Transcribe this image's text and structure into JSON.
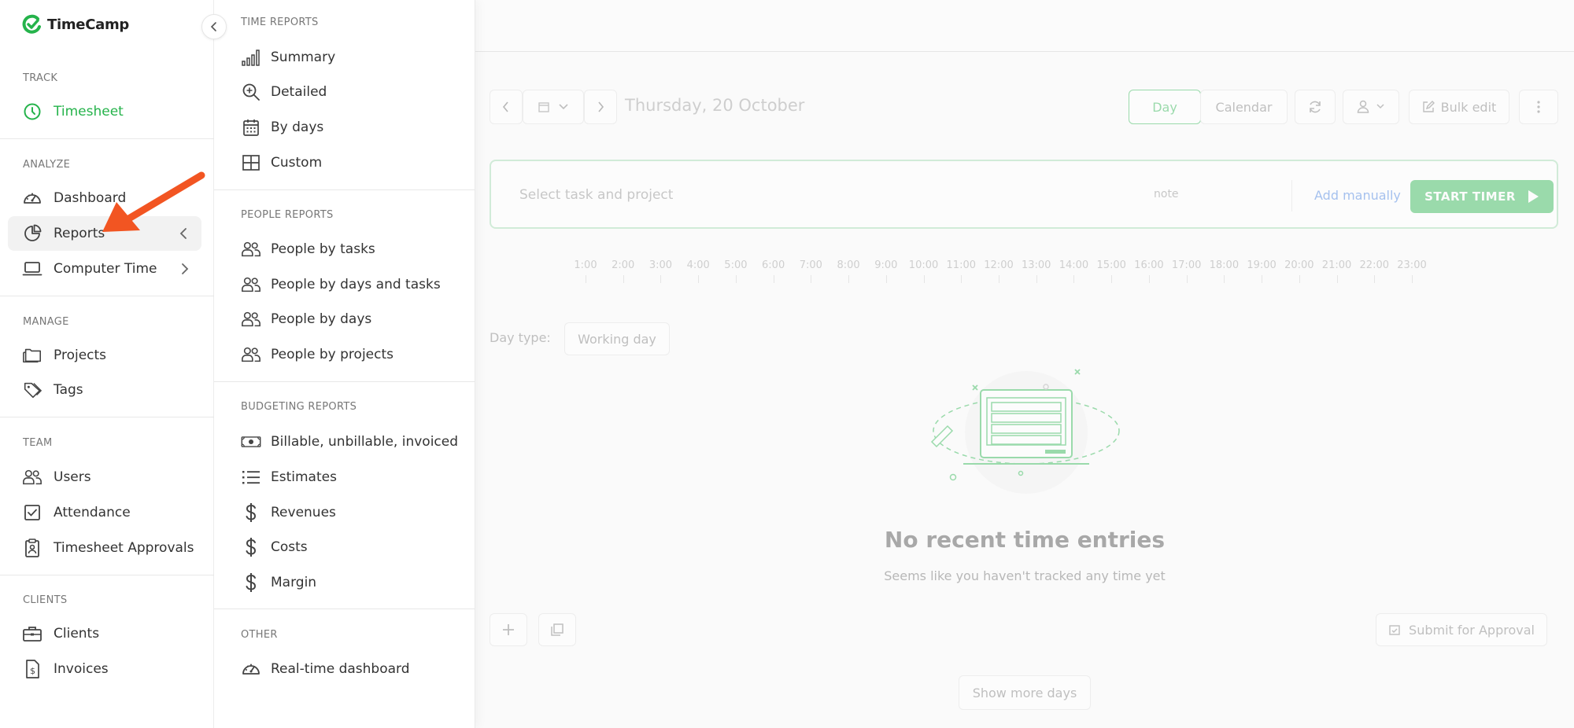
{
  "brand": {
    "name": "TimeCamp",
    "accent": "#25b34b"
  },
  "sidebar": {
    "sections": [
      {
        "title": "TRACK",
        "items": [
          {
            "label": "Timesheet",
            "icon": "clock-icon"
          }
        ]
      },
      {
        "title": "ANALYZE",
        "items": [
          {
            "label": "Dashboard",
            "icon": "gauge-icon"
          },
          {
            "label": "Reports",
            "icon": "pie-chart-icon"
          },
          {
            "label": "Computer Time",
            "icon": "laptop-icon"
          }
        ]
      },
      {
        "title": "MANAGE",
        "items": [
          {
            "label": "Projects",
            "icon": "folder-icon"
          },
          {
            "label": "Tags",
            "icon": "tag-icon"
          }
        ]
      },
      {
        "title": "TEAM",
        "items": [
          {
            "label": "Users",
            "icon": "users-icon"
          },
          {
            "label": "Attendance",
            "icon": "checkbox-icon"
          },
          {
            "label": "Timesheet Approvals",
            "icon": "clipboard-icon"
          }
        ]
      },
      {
        "title": "CLIENTS",
        "items": [
          {
            "label": "Clients",
            "icon": "briefcase-icon"
          },
          {
            "label": "Invoices",
            "icon": "invoice-icon"
          }
        ]
      }
    ]
  },
  "submenu": {
    "sections": [
      {
        "title": "TIME REPORTS",
        "items": [
          {
            "label": "Summary",
            "icon": "bar-chart-icon"
          },
          {
            "label": "Detailed",
            "icon": "zoom-in-icon"
          },
          {
            "label": "By days",
            "icon": "calendar-icon"
          },
          {
            "label": "Custom",
            "icon": "grid-icon"
          }
        ]
      },
      {
        "title": "PEOPLE REPORTS",
        "items": [
          {
            "label": "People by tasks",
            "icon": "users-icon"
          },
          {
            "label": "People by days and tasks",
            "icon": "users-icon"
          },
          {
            "label": "People by days",
            "icon": "users-icon"
          },
          {
            "label": "People by projects",
            "icon": "users-icon"
          }
        ]
      },
      {
        "title": "BUDGETING REPORTS",
        "items": [
          {
            "label": "Billable, unbillable, invoiced",
            "icon": "banknote-icon"
          },
          {
            "label": "Estimates",
            "icon": "list-icon"
          },
          {
            "label": "Revenues",
            "icon": "dollar-icon"
          },
          {
            "label": "Costs",
            "icon": "dollar-icon"
          },
          {
            "label": "Margin",
            "icon": "dollar-icon"
          }
        ]
      },
      {
        "title": "OTHER",
        "items": [
          {
            "label": "Real-time dashboard",
            "icon": "gauge-icon"
          }
        ]
      }
    ]
  },
  "main": {
    "date_label": "Thursday, 20 October",
    "view_toggle": {
      "day": "Day",
      "calendar": "Calendar"
    },
    "bulk_edit": "Bulk edit",
    "timer": {
      "task_placeholder": "Select task and project",
      "note_placeholder": "note",
      "add_manually": "Add manually",
      "start_timer": "START TIMER"
    },
    "hours": [
      "1:00",
      "2:00",
      "3:00",
      "4:00",
      "5:00",
      "6:00",
      "7:00",
      "8:00",
      "9:00",
      "10:00",
      "11:00",
      "12:00",
      "13:00",
      "14:00",
      "15:00",
      "16:00",
      "17:00",
      "18:00",
      "19:00",
      "20:00",
      "21:00",
      "22:00",
      "23:00"
    ],
    "day_type_label": "Day type:",
    "day_type_value": "Working day",
    "empty_title": "No recent time entries",
    "empty_subtitle": "Seems like you haven't tracked any time yet",
    "submit_for_approval": "Submit for Approval",
    "show_more_days": "Show more days"
  }
}
